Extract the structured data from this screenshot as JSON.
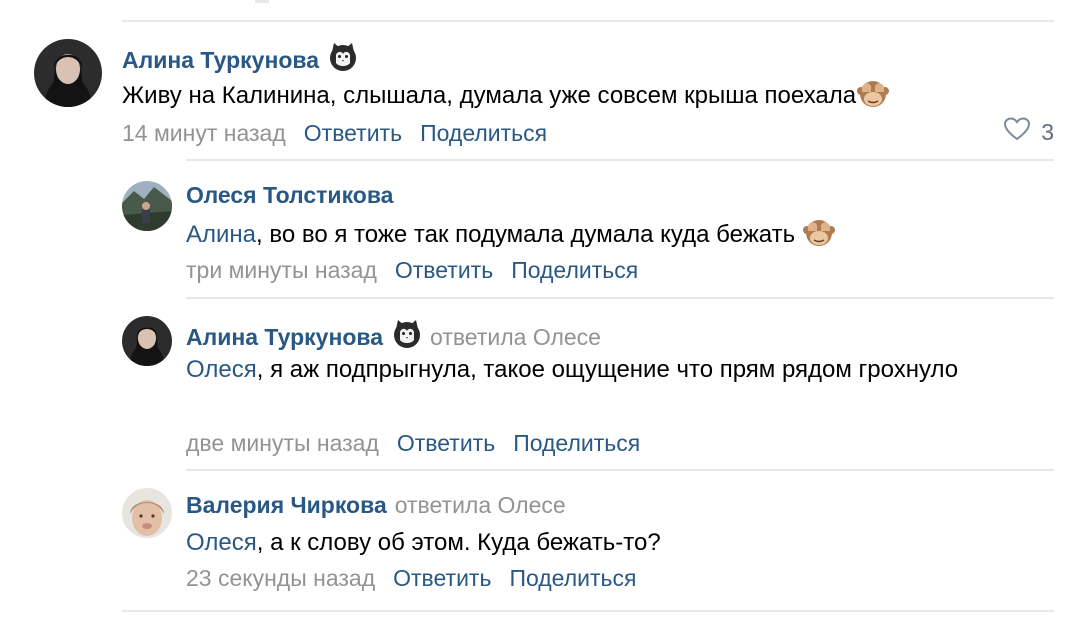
{
  "comments": [
    {
      "author": "Алина Туркунова",
      "reply_to": "",
      "mention": "",
      "text": "Живу на Калинина, слышала, думала уже совсем крыша поехала",
      "time": "14 минут назад",
      "reply_label": "Ответить",
      "share_label": "Поделиться",
      "likes": "3"
    },
    {
      "author": "Олеся Толстикова",
      "reply_to": "",
      "mention": "Алина",
      "text": ", во во я тоже так подумала думала куда бежать",
      "time": "три минуты назад",
      "reply_label": "Ответить",
      "share_label": "Поделиться"
    },
    {
      "author": "Алина Туркунова",
      "reply_to": "ответила Олесе",
      "mention": "Олеся",
      "text": ", я аж подпрыгнула, такое ощущение что прям рядом грохнуло",
      "time": "две минуты назад",
      "reply_label": "Ответить",
      "share_label": "Поделиться"
    },
    {
      "author": "Валерия Чиркова",
      "reply_to": "ответила Олесе",
      "mention": "Олеся",
      "text": ", а к слову об этом. Куда бежать-то?",
      "time": "23 секунды назад",
      "reply_label": "Ответить",
      "share_label": "Поделиться"
    }
  ],
  "icons": {
    "badge": "cat-badge-icon",
    "emoji": "see-no-evil-monkey-icon",
    "like": "heart-outline-icon"
  },
  "colors": {
    "link": "#2a5885",
    "muted": "#939393",
    "divider": "#e7e8ec"
  }
}
